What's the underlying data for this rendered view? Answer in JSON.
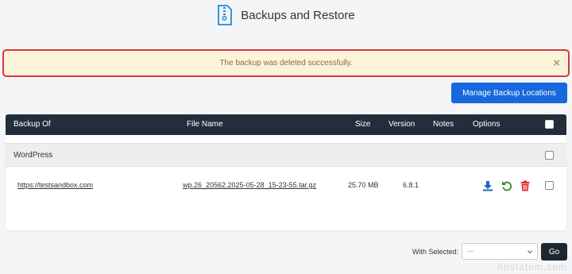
{
  "header": {
    "title": "Backups and Restore",
    "icon": "zip-file-icon"
  },
  "alert": {
    "message": "The backup was deleted successfully.",
    "close": "×"
  },
  "actions": {
    "manage_label": "Manage Backup Locations"
  },
  "table": {
    "columns": [
      "Backup Of",
      "File Name",
      "Size",
      "Version",
      "Notes",
      "Options"
    ],
    "groups": [
      {
        "name": "WordPress",
        "rows": [
          {
            "backup_of": "https://testsandbox.com",
            "file_name": "wp.26_20562.2025-05-28_15-23-55.tar.gz",
            "size": "25.70 MB",
            "version": "6.8.1",
            "notes": ""
          }
        ]
      }
    ]
  },
  "footer": {
    "with_selected": "With Selected:",
    "select_value": "---",
    "go_label": "Go"
  },
  "watermark": "hostatom.com",
  "colors": {
    "accent": "#1668dc",
    "header_bg": "#222e3c",
    "alert_bg": "#fcf4d8",
    "alert_border": "#d9363e",
    "restore": "#2e8b2e",
    "delete": "#e02424"
  }
}
